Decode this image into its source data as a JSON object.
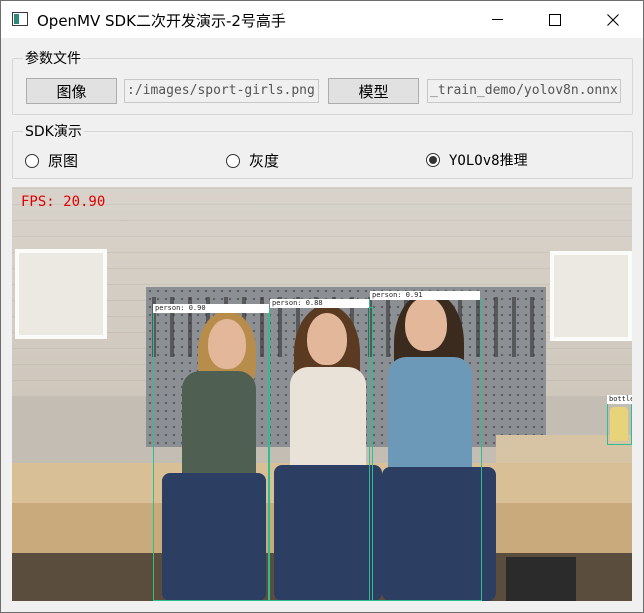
{
  "window": {
    "title": "OpenMV SDK二次开发演示-2号高手",
    "icon": "app-window-icon",
    "controls": [
      "minimize-icon",
      "maximize-icon",
      "close-icon"
    ]
  },
  "params_group": {
    "title": "参数文件",
    "image_button": "图像",
    "image_path": ":/images/sport-girls.png",
    "model_button": "模型",
    "model_path": "_train_demo/yolov8n.onnx"
  },
  "demo_group": {
    "title": "SDK演示",
    "options": [
      {
        "label": "原图",
        "checked": false
      },
      {
        "label": "灰度",
        "checked": false
      },
      {
        "label": "YOLOv8推理",
        "checked": true
      }
    ]
  },
  "viewer": {
    "fps_text": "FPS: 20.90",
    "fps_color": "#e00000",
    "box_color": "#2fbf8f",
    "detections": [
      {
        "label": "person: 0.90"
      },
      {
        "label": "person: 0.88"
      },
      {
        "label": "person: 0.91"
      },
      {
        "label": "bottle"
      }
    ]
  }
}
